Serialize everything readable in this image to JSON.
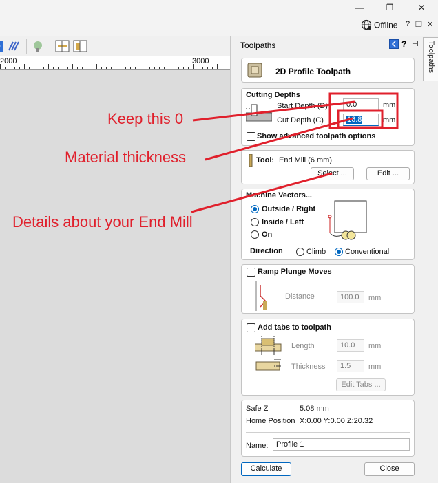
{
  "window": {
    "minimize_label": "—",
    "restore_label": "❐",
    "close_label": "✕"
  },
  "menu": {
    "offline_label": "Offline",
    "help_label": "?"
  },
  "ruler": {
    "labels": [
      "2000",
      "3000"
    ]
  },
  "panel": {
    "title": "Toolpaths",
    "side_tab": "Toolpaths",
    "header_title": "2D Profile Toolpath",
    "cutting_depths": {
      "heading": "Cutting Depths",
      "start_depth_label": "Start Depth (D)",
      "start_depth_value": "0.0",
      "start_depth_unit": "mm",
      "cut_depth_label": "Cut Depth (C)",
      "cut_depth_value": "16.8",
      "cut_depth_unit": "mm",
      "advanced_label": "Show advanced toolpath options"
    },
    "tool": {
      "label": "Tool:",
      "name": "End Mill (6 mm)",
      "select_label": "Select ...",
      "edit_label": "Edit ..."
    },
    "machine_vectors": {
      "heading": "Machine Vectors...",
      "outside_label": "Outside / Right",
      "inside_label": "Inside / Left",
      "on_label": "On",
      "direction_label": "Direction",
      "climb_label": "Climb",
      "conventional_label": "Conventional"
    },
    "ramp": {
      "heading": "Ramp Plunge Moves",
      "distance_label": "Distance",
      "distance_value": "100.0",
      "distance_unit": "mm"
    },
    "tabs": {
      "heading": "Add tabs to toolpath",
      "length_label": "Length",
      "length_value": "10.0",
      "length_unit": "mm",
      "thickness_label": "Thickness",
      "thickness_value": "1.5",
      "thickness_unit": "mm",
      "edit_tabs_label": "Edit Tabs ..."
    },
    "info": {
      "safe_z_label": "Safe Z",
      "safe_z_value": "5.08 mm",
      "home_label": "Home Position",
      "home_value": "X:0.00 Y:0.00 Z:20.32"
    },
    "name_label": "Name:",
    "name_value": "Profile 1",
    "calculate_label": "Calculate",
    "close_label": "Close"
  },
  "annotations": {
    "keep_zero": "Keep this 0",
    "material_thickness": "Material thickness",
    "end_mill_details": "Details about your End Mill",
    "color": "#e0202c"
  }
}
